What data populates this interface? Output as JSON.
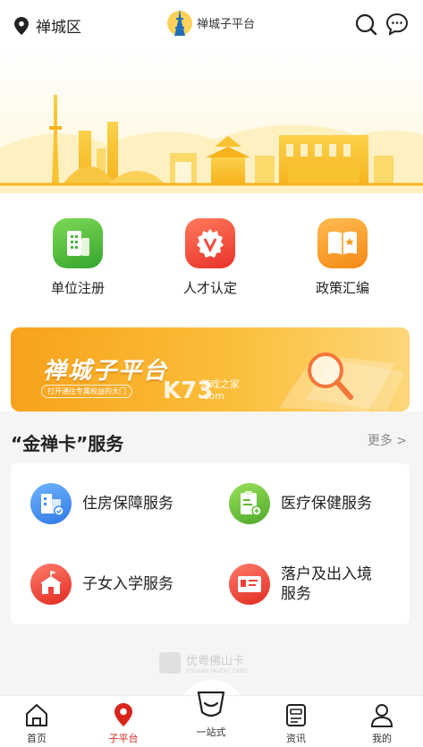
{
  "header": {
    "location": "禅城区",
    "brand": "禅城子平台"
  },
  "quick_entries": [
    {
      "label": "单位注册",
      "icon": "building-icon",
      "color": "#46b53a"
    },
    {
      "label": "人才认定",
      "icon": "v-badge-icon",
      "color": "#ef4a3c"
    },
    {
      "label": "政策汇编",
      "icon": "book-icon",
      "color": "#f79a1e"
    }
  ],
  "promo": {
    "title": "禅城子平台",
    "subtitle": "打开通往专属权益的大门",
    "watermark": "K73",
    "watermark_sub1": "游戏之家",
    "watermark_sub2": ".com"
  },
  "section": {
    "title": "“金禅卡”服务",
    "more": "更多 >"
  },
  "services": [
    {
      "label": "住房保障服务",
      "icon": "housing-icon",
      "color": "#3e8ef0"
    },
    {
      "label": "医疗保健服务",
      "icon": "medical-icon",
      "color": "#62bb34"
    },
    {
      "label": "子女入学服务",
      "icon": "school-icon",
      "color": "#ef4236"
    },
    {
      "label": "落户及出入境服务",
      "line1": "落户及出入境",
      "line2": "服务",
      "icon": "passport-icon",
      "color": "#ef4236"
    }
  ],
  "footer_mark": {
    "text": "优粤佛山卡",
    "sub": "FOSHAN TALENT CARD"
  },
  "tabs": [
    {
      "label": "首页",
      "icon": "home-icon"
    },
    {
      "label": "子平台",
      "icon": "location-pin-icon",
      "active": true
    },
    {
      "label": "一站式",
      "icon": "one-stop-icon"
    },
    {
      "label": "资讯",
      "icon": "news-icon"
    },
    {
      "label": "我的",
      "icon": "profile-icon"
    }
  ]
}
